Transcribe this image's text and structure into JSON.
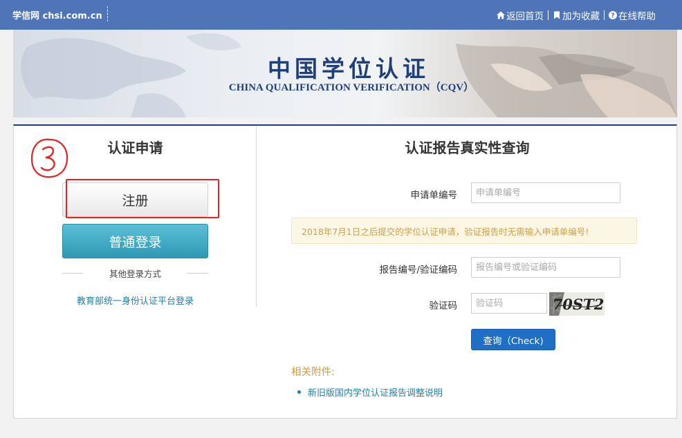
{
  "header": {
    "brand": "学信网 chsi.com.cn",
    "links": [
      {
        "label": "返回首页",
        "icon": "home-icon"
      },
      {
        "label": "加为收藏",
        "icon": "bookmark-icon"
      },
      {
        "label": "在线帮助",
        "icon": "help-icon"
      }
    ]
  },
  "banner": {
    "title": "中国学位认证",
    "subtitle": "CHINA QUALIFICATION VERIFICATION（CQV）"
  },
  "left_panel": {
    "title": "认证申请",
    "register_label": "注册",
    "login_label": "普通登录",
    "other_login_label": "其他登录方式",
    "moe_link": "教育部统一身份认证平台登录"
  },
  "right_panel": {
    "title": "认证报告真实性查询",
    "application_no": {
      "label": "申请单编号",
      "placeholder": "申请单编号"
    },
    "notice": "2018年7月1日之后提交的学位认证申请，验证报告时无需输入申请单编号!",
    "report_no": {
      "label": "报告编号/验证编码",
      "placeholder": "报告编号或验证编码"
    },
    "captcha": {
      "label": "验证码",
      "placeholder": "验证码",
      "image_text": "70ST2"
    },
    "check_button": "查询（Check)",
    "attachments_title": "相关附件:",
    "attachments": [
      "新旧版国内学位认证报告调整说明"
    ]
  },
  "colors": {
    "topbar": "#4f74b8",
    "banner_text": "#203e78",
    "login_button": "#2e98b6",
    "check_button": "#1f6fc6",
    "annotation": "#e62222",
    "notice_text": "#c9a04c"
  }
}
